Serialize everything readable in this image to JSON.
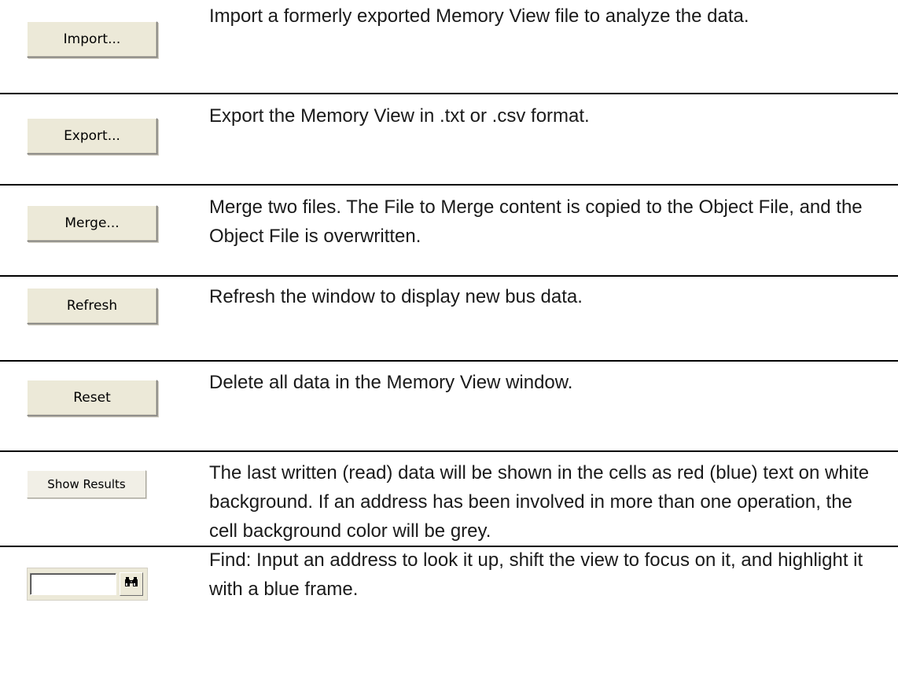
{
  "rows": [
    {
      "button_label": "Import...",
      "description": "Import a formerly exported Memory View file to analyze the data."
    },
    {
      "button_label": "Export...",
      "description": "Export the Memory View in .txt or .csv format."
    },
    {
      "button_label": "Merge...",
      "description": "Merge two files. The File to Merge content is copied to the Object File, and the Object File is overwritten."
    },
    {
      "button_label": "Refresh",
      "description": "Refresh the window to display new bus data."
    },
    {
      "button_label": "Reset",
      "description": "Delete all data in the Memory View window."
    },
    {
      "button_label": "Show Results",
      "description": "The last written (read) data will be shown in the cells as red (blue) text on white background. If an address has been involved in more than one operation, the cell background color will be grey."
    },
    {
      "find_input_value": "",
      "find_icon": "binoculars-icon",
      "description": "Find: Input an address to look it up, shift the view to focus on it, and highlight it with a blue frame."
    }
  ]
}
